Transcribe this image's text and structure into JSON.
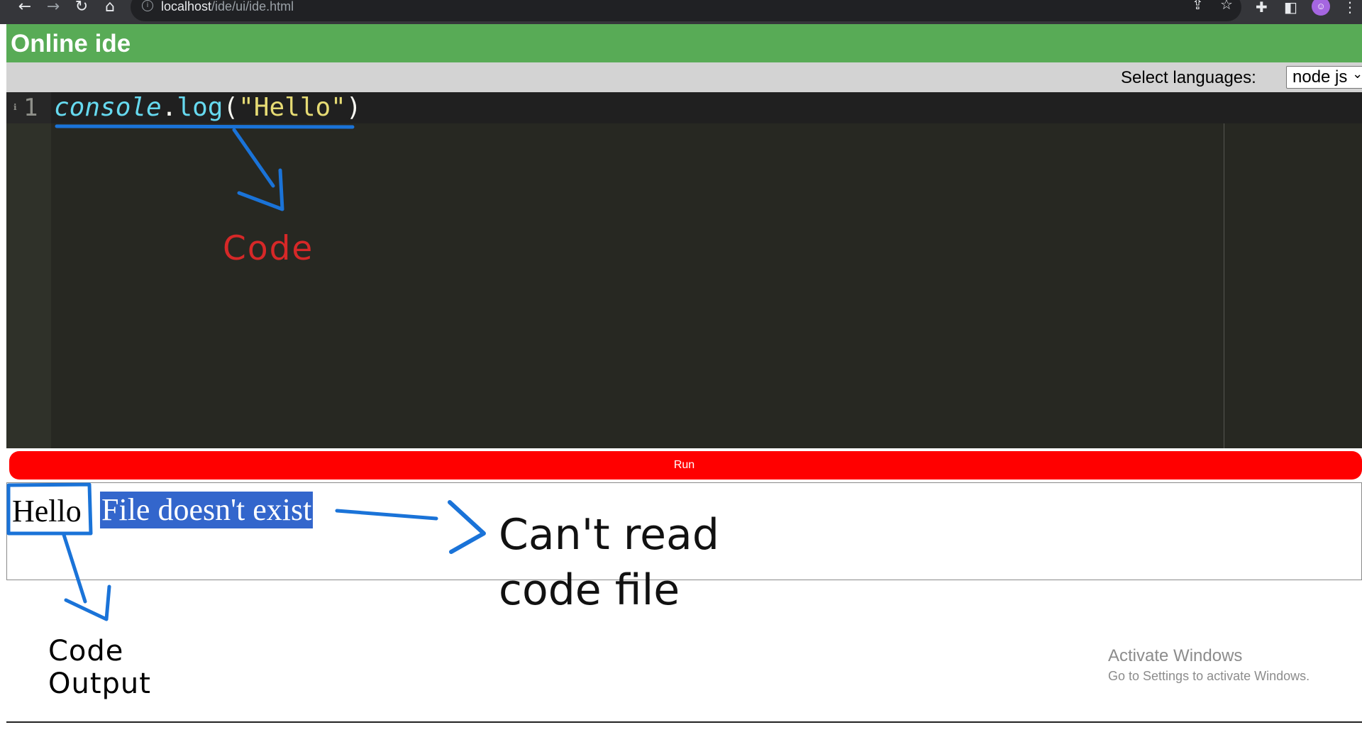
{
  "browser": {
    "back_icon": "←",
    "forward_icon": "→",
    "reload_icon": "↻",
    "home_icon": "⌂",
    "info_icon": "i",
    "url_host": "localhost",
    "url_path": "/ide/ui/ide.html",
    "share_icon": "⇪",
    "star_icon": "☆",
    "extensions_icon": "✚",
    "sidepanel_icon": "◧",
    "menu_icon": "⋮"
  },
  "header": {
    "title": "Online ide"
  },
  "language": {
    "label": "Select languages:",
    "selected": "node js",
    "chevron": "⌄"
  },
  "editor": {
    "line_number": "1",
    "fold_mark": "ℹ",
    "code": {
      "object": "console",
      "dot": ".",
      "method": "log",
      "open": "(",
      "string": "\"Hello\"",
      "close": ")"
    }
  },
  "run": {
    "label": "Run"
  },
  "output": {
    "stdout": "Hello",
    "error": "File doesn't exist"
  },
  "annotations": {
    "code_label": "Code",
    "error_note_line1": "Can't read",
    "error_note_line2": "code file",
    "output_label_line1": "Code",
    "output_label_line2": "Output"
  },
  "watermark": {
    "title": "Activate Windows",
    "subtitle": "Go to Settings to activate Windows."
  },
  "colors": {
    "header_green": "#58ab56",
    "run_red": "#ff0000",
    "annotation_blue": "#1a73d8",
    "annotation_red": "#d62828",
    "error_highlight": "#3366cc"
  }
}
